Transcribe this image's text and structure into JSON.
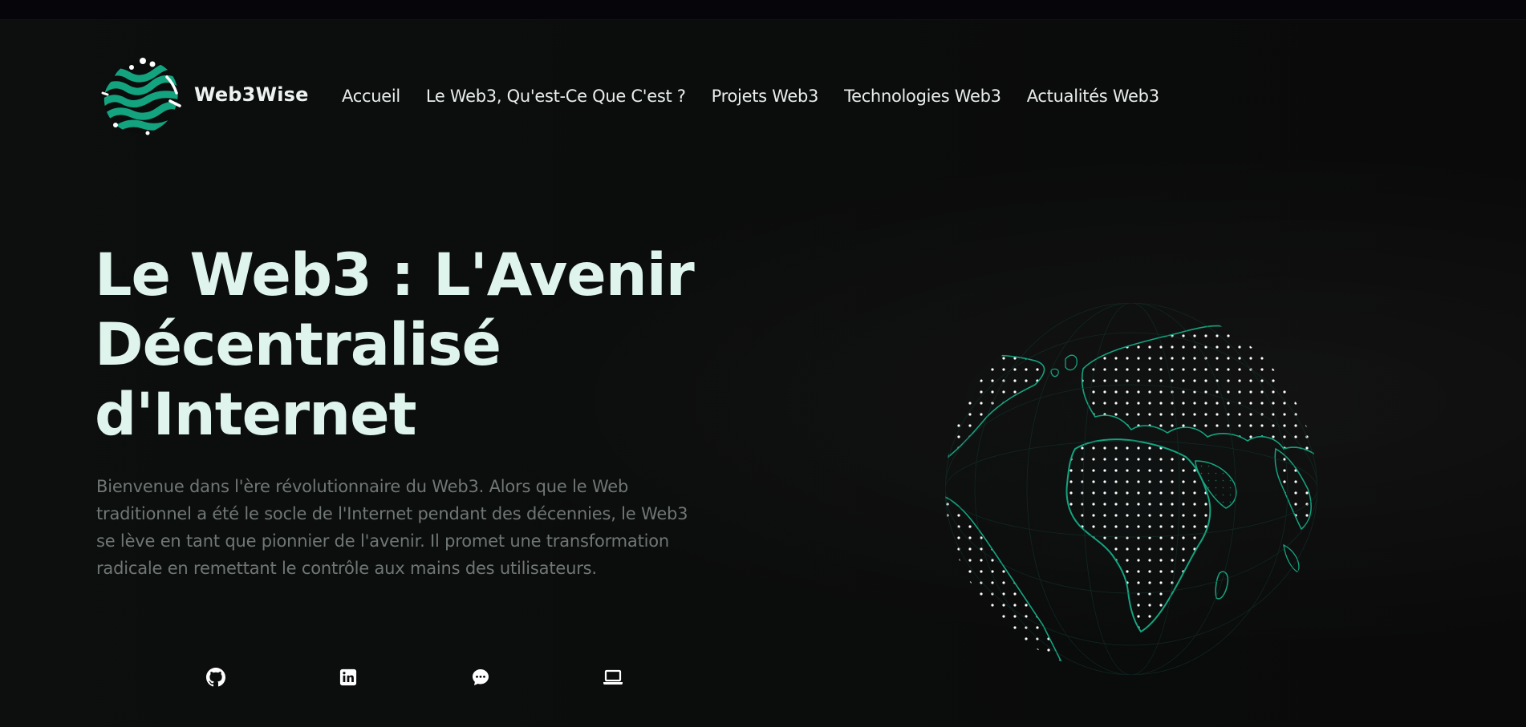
{
  "header": {
    "brand": "Web3Wise",
    "logo_icon": "web3wise-logo-icon"
  },
  "nav": {
    "items": [
      {
        "label": "Accueil"
      },
      {
        "label": "Le Web3, Qu'est-Ce Que C'est ?"
      },
      {
        "label": "Projets Web3"
      },
      {
        "label": "Technologies Web3"
      },
      {
        "label": "Actualités Web3"
      }
    ]
  },
  "hero": {
    "title_line1": "Le Web3 : L'Avenir",
    "title_line2": "Décentralisé",
    "title_line3": "d'Internet",
    "subtitle": "Bienvenue dans l'ère révolutionnaire du Web3. Alors que le Web traditionnel a été le socle de l'Internet pendant des décennies, le Web3 se lève en tant que pionnier de l'avenir. Il promet une transformation radicale en remettant le contrôle aux mains des utilisateurs."
  },
  "socials": [
    {
      "icon": "github-icon"
    },
    {
      "icon": "linkedin-icon"
    },
    {
      "icon": "chat-bubble-icon"
    },
    {
      "icon": "laptop-icon"
    }
  ],
  "illustration": {
    "icon": "globe-icon"
  },
  "colors": {
    "accent": "#14a37f",
    "background": "#0b0c0c",
    "title": "#def4ec",
    "subtitle": "#6f7774",
    "nav_text": "#e8eeec"
  }
}
